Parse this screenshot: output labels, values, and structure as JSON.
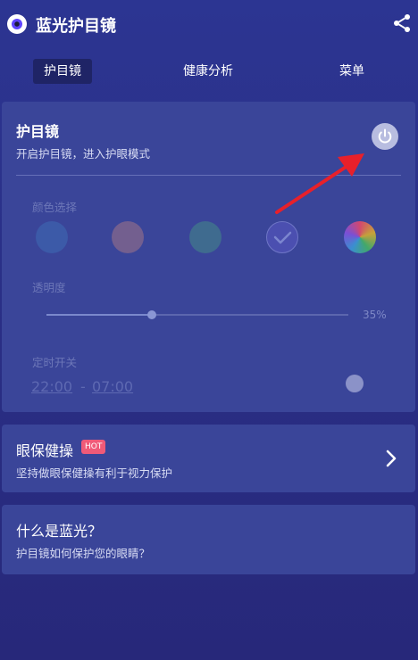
{
  "app_bar": {
    "title": "蓝光护目镜",
    "share_icon": "share-icon",
    "logo_icon": "eye-logo-icon"
  },
  "tabs": [
    {
      "label": "护目镜",
      "active": true
    },
    {
      "label": "健康分析",
      "active": false
    },
    {
      "label": "菜单",
      "active": false
    }
  ],
  "eye_protection": {
    "title": "护目镜",
    "subtitle": "开启护目镜，进入护眼模式",
    "enabled": false,
    "power_icon": "power-icon",
    "color_label": "颜色选择",
    "colors": [
      "#3c5aa8",
      "#735f8f",
      "#3f6b8f",
      "#4b4fb0",
      "rainbow"
    ],
    "selected_color_index": 3,
    "opacity_label": "透明度",
    "opacity_value": "35%",
    "opacity_fraction": 0.35,
    "timer_label": "定时开关",
    "timer_start": "22:00",
    "timer_separator": "-",
    "timer_end": "07:00",
    "timer_enabled": false
  },
  "eye_exercise": {
    "title": "眼保健操",
    "badge": "HOT",
    "subtitle": "坚持做眼保健操有利于视力保护",
    "chevron_icon": "chevron-right-icon"
  },
  "blue_light_info": {
    "title": "什么是蓝光？",
    "subtitle": "护目镜如何保护您的眼睛？"
  },
  "colors": {
    "background": "#2a2f86",
    "card": "#3a4599",
    "active_tab": "#1f2466",
    "hot_badge": "#f05a78",
    "annotation_arrow": "#e8202a"
  }
}
